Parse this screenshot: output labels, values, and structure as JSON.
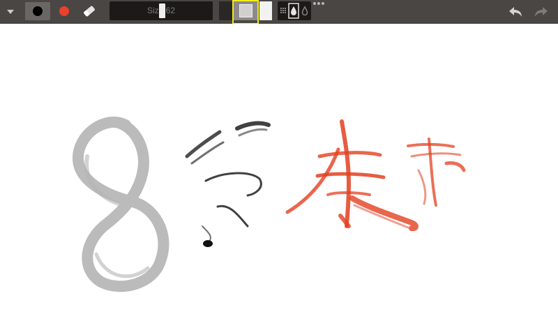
{
  "toolbar": {
    "size_label": "Size 62",
    "icons": {
      "menu": "triangle-down-icon",
      "brush": "brush-tip-icon",
      "color": "color-swatch-icon",
      "eraser": "eraser-icon",
      "grid": "grid-icon",
      "ink": "ink-drop-icon",
      "water": "water-drop-icon",
      "more": "more-dots-icon",
      "undo": "undo-arrow-icon",
      "redo": "redo-arrow-icon"
    }
  },
  "colors": {
    "toolbar_bg": "#4a4644",
    "active_color": "#e8412e",
    "ink_gray": "#b4b4b4",
    "ink_black": "#111111",
    "ink_red": "#e3401f",
    "highlight": "#f1ec1e"
  }
}
